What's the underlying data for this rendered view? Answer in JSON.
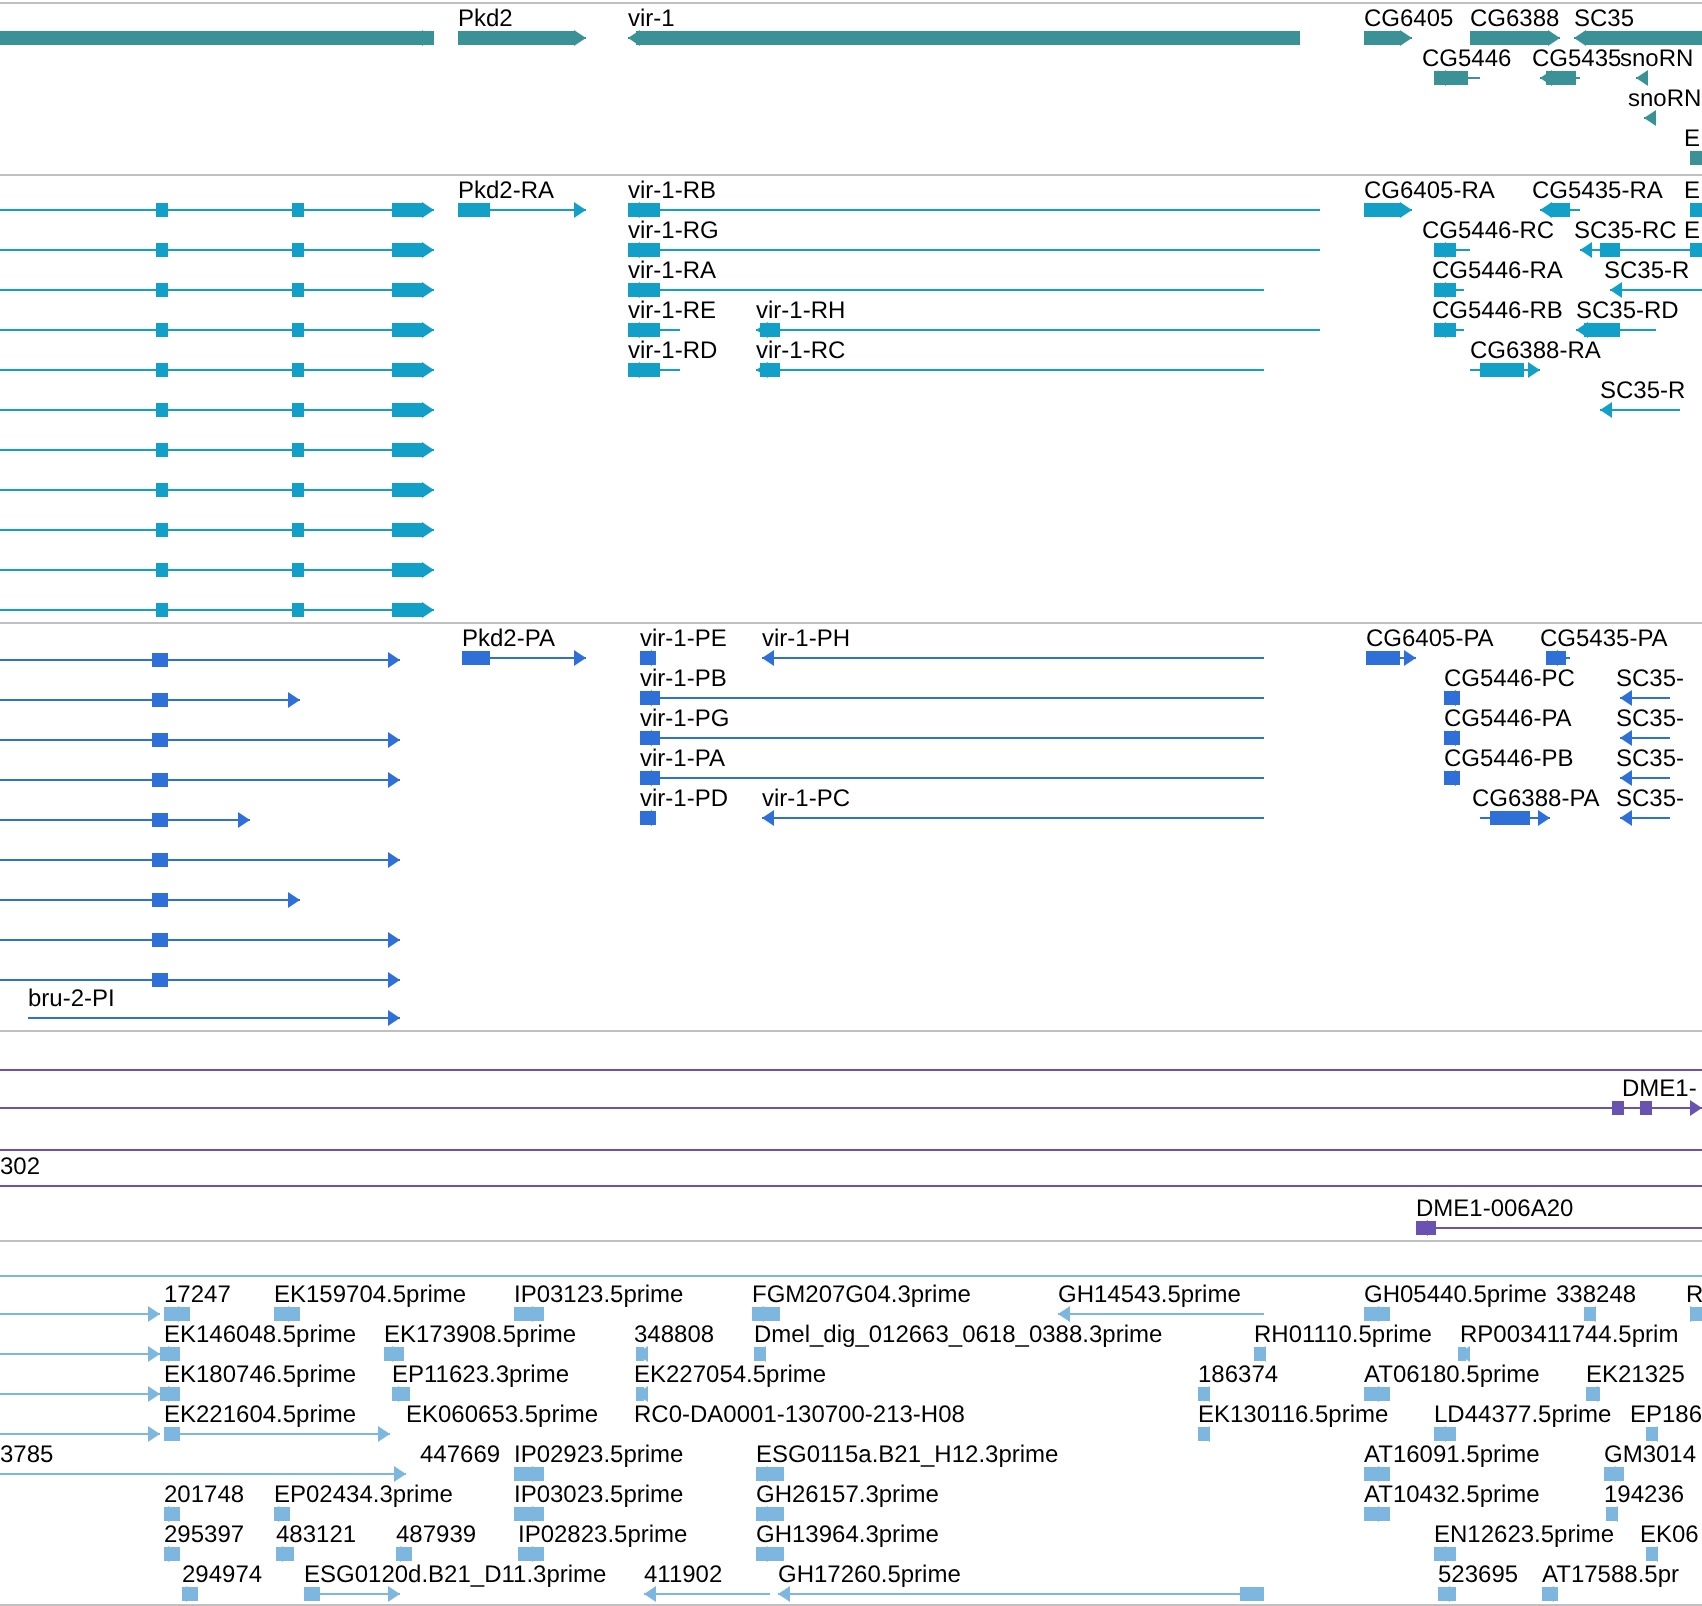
{
  "tracks": [
    {
      "kind": "genes",
      "color": "#3a9196",
      "features": [
        {
          "label": "Pkd2",
          "reverse": false
        },
        {
          "label": "vir-1",
          "reverse": true
        },
        {
          "label": "CG6405",
          "reverse": false
        },
        {
          "label": "CG6388",
          "reverse": false
        },
        {
          "label": "SC35",
          "reverse": true
        },
        {
          "label": "CG5446",
          "reverse": true
        },
        {
          "label": "CG5435",
          "reverse": true
        },
        {
          "label": "snoRN",
          "reverse": true
        },
        {
          "label": "snoRN",
          "reverse": true
        },
        {
          "label": "E"
        }
      ]
    },
    {
      "kind": "transcripts",
      "color": "#12a0c8",
      "features": [
        {
          "label": "Pkd2-RA",
          "reverse": false
        },
        {
          "label": "vir-1-RB",
          "reverse": true
        },
        {
          "label": "CG6405-RA",
          "reverse": false
        },
        {
          "label": "CG5435-RA",
          "reverse": true
        },
        {
          "label": "E"
        },
        {
          "label": "vir-1-RG",
          "reverse": true
        },
        {
          "label": "CG5446-RC",
          "reverse": true
        },
        {
          "label": "SC35-RC",
          "reverse": true
        },
        {
          "label": "E"
        },
        {
          "label": "vir-1-RA",
          "reverse": true
        },
        {
          "label": "CG5446-RA",
          "reverse": true
        },
        {
          "label": "SC35-R",
          "reverse": true
        },
        {
          "label": "vir-1-RE",
          "reverse": true
        },
        {
          "label": "vir-1-RH",
          "reverse": true
        },
        {
          "label": "CG5446-RB",
          "reverse": true
        },
        {
          "label": "SC35-RD",
          "reverse": true
        },
        {
          "label": "vir-1-RD",
          "reverse": true
        },
        {
          "label": "vir-1-RC",
          "reverse": true
        },
        {
          "label": "CG6388-RA",
          "reverse": false
        },
        {
          "label": "SC35-R",
          "reverse": true
        }
      ]
    },
    {
      "kind": "transcripts",
      "color": "#2e6fd8",
      "features": [
        {
          "label": "Pkd2-PA",
          "reverse": false
        },
        {
          "label": "vir-1-PE",
          "reverse": true
        },
        {
          "label": "vir-1-PH",
          "reverse": true
        },
        {
          "label": "CG6405-PA",
          "reverse": false
        },
        {
          "label": "CG5435-PA",
          "reverse": true
        },
        {
          "label": "vir-1-PB",
          "reverse": true
        },
        {
          "label": "CG5446-PC",
          "reverse": true
        },
        {
          "label": "SC35-",
          "reverse": true
        },
        {
          "label": "vir-1-PG",
          "reverse": true
        },
        {
          "label": "CG5446-PA",
          "reverse": true
        },
        {
          "label": "SC35-",
          "reverse": true
        },
        {
          "label": "vir-1-PA",
          "reverse": true
        },
        {
          "label": "CG5446-PB",
          "reverse": true
        },
        {
          "label": "SC35-",
          "reverse": true
        },
        {
          "label": "vir-1-PD",
          "reverse": true
        },
        {
          "label": "vir-1-PC",
          "reverse": true
        },
        {
          "label": "CG6388-PA",
          "reverse": false
        },
        {
          "label": "SC35-",
          "reverse": true
        },
        {
          "label": "bru-2-PI",
          "reverse": false
        }
      ]
    },
    {
      "kind": "clones",
      "color": "#6a52b0",
      "features": [
        {
          "label": "DME1-",
          "reverse": false
        },
        {
          "label": "302"
        },
        {
          "label": "DME1-006A20",
          "reverse": true
        }
      ]
    },
    {
      "kind": "ests",
      "color": "#7db6df",
      "features": [
        {
          "label": "17247",
          "reverse": false
        },
        {
          "label": "EK159704.5prime",
          "reverse": false
        },
        {
          "label": "IP03123.5prime",
          "reverse": false
        },
        {
          "label": "FGM207G04.3prime",
          "reverse": true
        },
        {
          "label": "GH14543.5prime",
          "reverse": true
        },
        {
          "label": "GH05440.5prime",
          "reverse": false
        },
        {
          "label": "338248",
          "reverse": true
        },
        {
          "label": "R",
          "reverse": false
        },
        {
          "label": "EK146048.5prime",
          "reverse": false
        },
        {
          "label": "EK173908.5prime",
          "reverse": false
        },
        {
          "label": "348808",
          "reverse": true
        },
        {
          "label": "Dmel_dig_012663_0618_0388.3prime",
          "reverse": true
        },
        {
          "label": "RH01110.5prime",
          "reverse": true
        },
        {
          "label": "RP003411744.5prim",
          "reverse": true
        },
        {
          "label": "EK180746.5prime",
          "reverse": false
        },
        {
          "label": "EP11623.3prime",
          "reverse": false
        },
        {
          "label": "EK227054.5prime",
          "reverse": true
        },
        {
          "label": "186374",
          "reverse": true
        },
        {
          "label": "AT06180.5prime",
          "reverse": false
        },
        {
          "label": "EK21325",
          "reverse": true
        },
        {
          "label": "EK221604.5prime",
          "reverse": false
        },
        {
          "label": "EK060653.5prime"
        },
        {
          "label": "RC0-DA0001-130700-213-H08"
        },
        {
          "label": "EK130116.5prime",
          "reverse": true
        },
        {
          "label": "LD44377.5prime",
          "reverse": true
        },
        {
          "label": "EP186",
          "reverse": true
        },
        {
          "label": "3785",
          "reverse": false
        },
        {
          "label": "447669"
        },
        {
          "label": "IP02923.5prime",
          "reverse": false
        },
        {
          "label": "ESG0115a.B21_H12.3prime",
          "reverse": true
        },
        {
          "label": "AT16091.5prime",
          "reverse": false
        },
        {
          "label": "GM3014",
          "reverse": true
        },
        {
          "label": "201748",
          "reverse": false
        },
        {
          "label": "EP02434.3prime",
          "reverse": false
        },
        {
          "label": "IP03023.5prime",
          "reverse": false
        },
        {
          "label": "GH26157.3prime",
          "reverse": true
        },
        {
          "label": "AT10432.5prime",
          "reverse": false
        },
        {
          "label": "194236",
          "reverse": true
        },
        {
          "label": "295397",
          "reverse": false
        },
        {
          "label": "483121",
          "reverse": false
        },
        {
          "label": "487939",
          "reverse": false
        },
        {
          "label": "IP02823.5prime",
          "reverse": false
        },
        {
          "label": "GH13964.3prime",
          "reverse": true
        },
        {
          "label": "EN12623.5prime",
          "reverse": true
        },
        {
          "label": "EK06",
          "reverse": true
        },
        {
          "label": "294974",
          "reverse": false
        },
        {
          "label": "ESG0120d.B21_D11.3prime",
          "reverse": false
        },
        {
          "label": "411902",
          "reverse": true
        },
        {
          "label": "GH17260.5prime",
          "reverse": true
        },
        {
          "label": "523695",
          "reverse": true
        },
        {
          "label": "AT17588.5pr",
          "reverse": true
        }
      ]
    }
  ]
}
